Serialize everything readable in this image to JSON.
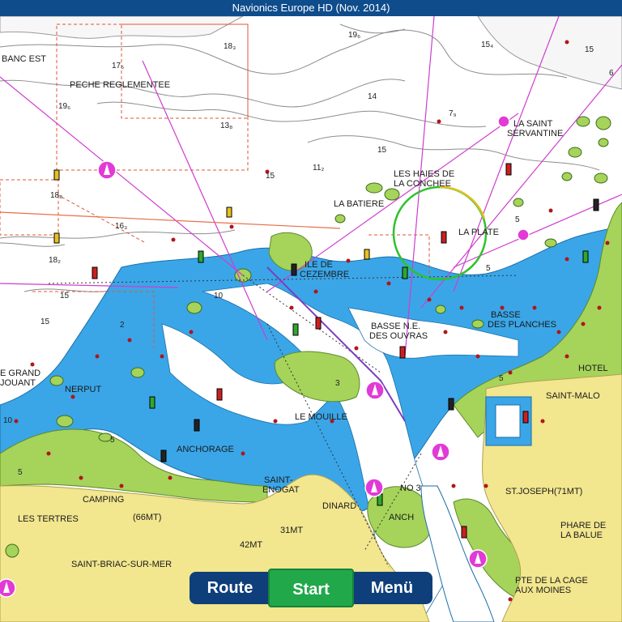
{
  "window": {
    "title": "Navionics Europe HD (Nov. 2014)"
  },
  "toolbar": {
    "route_label": "Route",
    "start_label": "Start",
    "menu_label": "Menü"
  },
  "colors": {
    "land": "#f2e68e",
    "intertidal": "#a6d35a",
    "shallow": "#3aa6e8",
    "deep": "#ffffff",
    "route_lines": "#d03cd0",
    "title_bar": "#0e4c8c",
    "start_button": "#21a84a"
  },
  "map": {
    "place_labels": {
      "banc_est": "BANC EST",
      "peche": "PECHE REGLEMENTEE",
      "la_saint": "LA SAINT",
      "servantine": "SERVANTINE",
      "haies1": "LES HAIES DE",
      "haies2": "LA CONCHEE",
      "batiere": "LA BATIERE",
      "plate": "LA PLATE",
      "ile_de": "ILE DE",
      "cezembre": "CEZEMBRE",
      "basse_planches1": "BASSE",
      "basse_planches2": "DES PLANCHES",
      "basse_ouvras1": "BASSE N.E.",
      "basse_ouvras2": "DES OUVRAS",
      "grand": "E GRAND",
      "jouant": "JOUANT",
      "nerput": "NERPUT",
      "hotel": "HOTEL",
      "saint_malo": "SAINT-MALO",
      "le_mouille": "LE MOUILLE",
      "anchorage": "ANCHORAGE",
      "saint_enogat1": "SAINT-",
      "saint_enogat2": "ENOGAT",
      "dinard": "DINARD",
      "no3": "NO 3",
      "anch": "ANCH",
      "camping": "CAMPING",
      "tertres": "LES TERTRES",
      "mt66": "(66MT)",
      "mt31": "31MT",
      "mt42": "42MT",
      "st_joseph": "ST.JOSEPH(71MT)",
      "balue1": "PHARE DE",
      "balue2": "LA BALUE",
      "saint_briac": "SAINT-BRIAC-SUR-MER",
      "cage1": "PTE DE LA CAGE",
      "cage2": "AUX MOINES"
    },
    "depths": [
      "19₆",
      "15₄",
      "15",
      "18₃",
      "17₆",
      "14",
      "13₈",
      "19₆",
      "7₉",
      "6",
      "15",
      "11₂",
      "15",
      "18₈",
      "16₃",
      "18₂",
      "15",
      "15",
      "10",
      "5",
      "2",
      "10",
      "5",
      "5",
      "3",
      "5",
      "5"
    ]
  }
}
